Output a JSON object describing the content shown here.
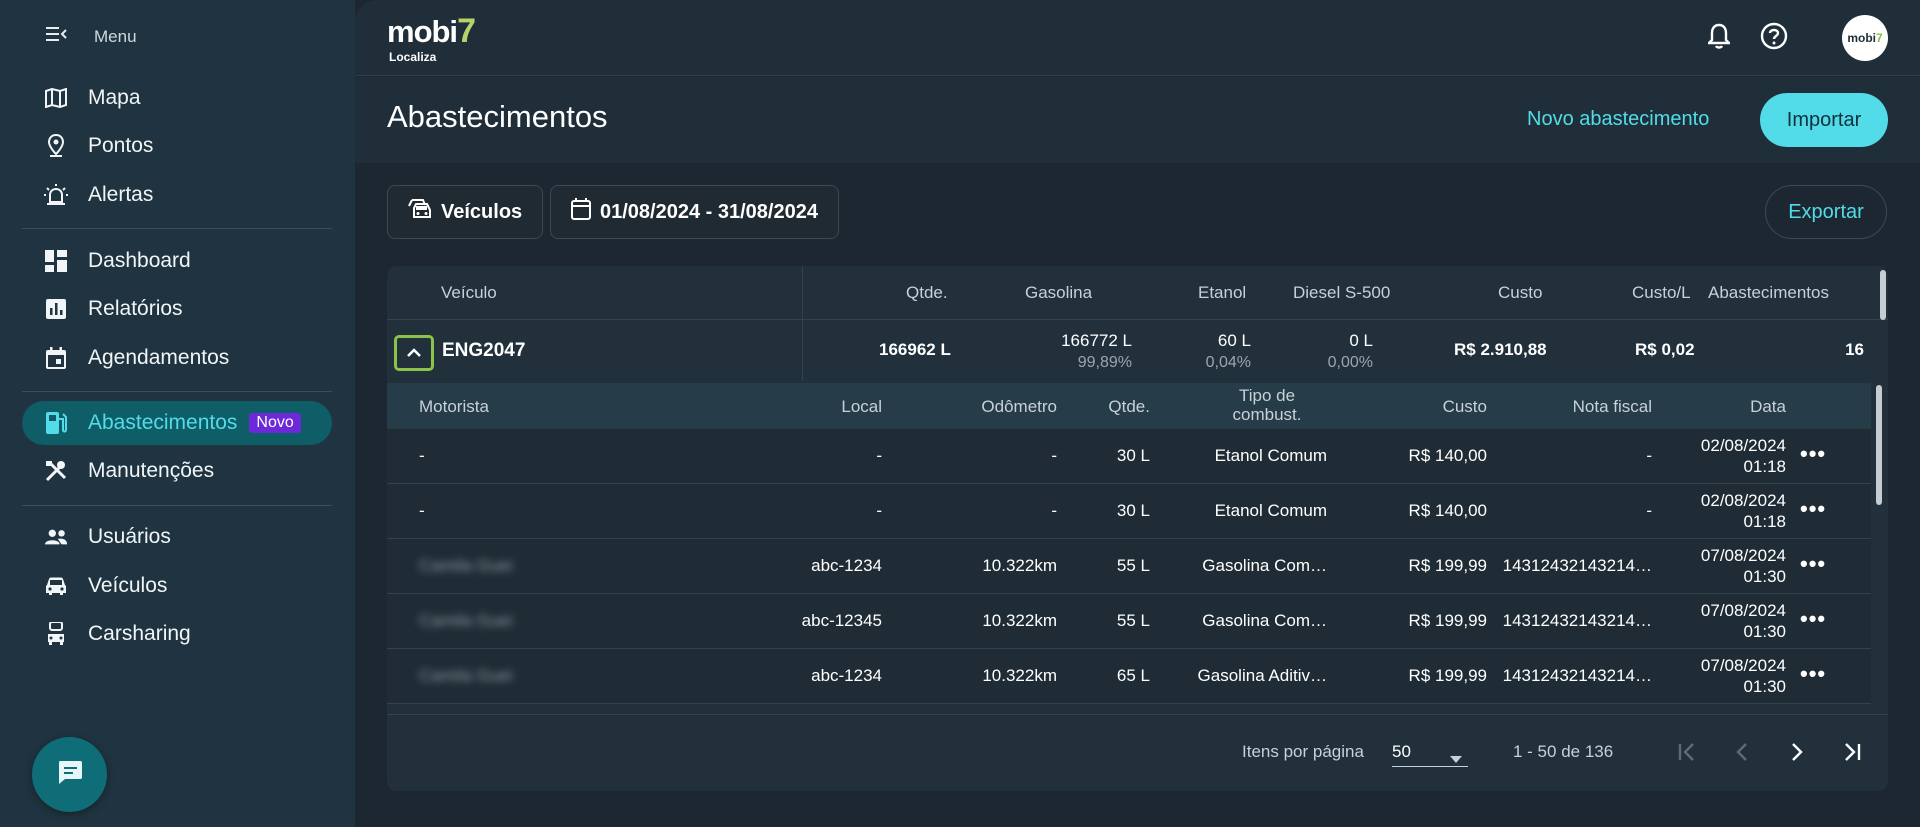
{
  "sidebar": {
    "menu_label": "Menu",
    "items": [
      {
        "label": "Mapa",
        "icon": "map-icon"
      },
      {
        "label": "Pontos",
        "icon": "pin-icon"
      },
      {
        "label": "Alertas",
        "icon": "siren-icon"
      },
      {
        "label": "Dashboard",
        "icon": "dashboard-icon"
      },
      {
        "label": "Relatórios",
        "icon": "report-icon"
      },
      {
        "label": "Agendamentos",
        "icon": "calendar-icon"
      },
      {
        "label": "Abastecimentos",
        "icon": "fuel-icon",
        "badge": "Novo",
        "active": true
      },
      {
        "label": "Manutenções",
        "icon": "tools-icon"
      },
      {
        "label": "Usuários",
        "icon": "users-icon"
      },
      {
        "label": "Veículos",
        "icon": "car-icon"
      },
      {
        "label": "Carsharing",
        "icon": "carsharing-icon"
      }
    ]
  },
  "header": {
    "logo_word": "mobi",
    "logo_seven": "7",
    "logo_sub": "Localiza",
    "avatar_text": "mobi",
    "avatar_seven": "7"
  },
  "page": {
    "title": "Abastecimentos",
    "new_link": "Novo abastecimento",
    "import_label": "Importar",
    "vehicles_filter": "Veículos",
    "date_range": "01/08/2024 - 31/08/2024",
    "export_label": "Exportar"
  },
  "vehicle_table": {
    "columns": [
      "Veículo",
      "Qtde.",
      "Gasolina",
      "Etanol",
      "Diesel S-500",
      "Custo",
      "Custo/L",
      "Abastecimentos"
    ],
    "row": {
      "plate": "ENG2047",
      "qtde": "166962 L",
      "gasolina": "166772 L",
      "gasolina_pct": "99,89%",
      "etanol": "60 L",
      "etanol_pct": "0,04%",
      "diesel": "0 L",
      "diesel_pct": "0,00%",
      "custo": "R$ 2.910,88",
      "custo_l": "R$ 0,02",
      "abastecimentos": "16"
    }
  },
  "detail_table": {
    "columns": {
      "motorista": "Motorista",
      "local": "Local",
      "odometro": "Odômetro",
      "qtde": "Qtde.",
      "tipo_1": "Tipo de",
      "tipo_2": "combust.",
      "custo": "Custo",
      "nota": "Nota fiscal",
      "data": "Data"
    },
    "rows": [
      {
        "motorista": "-",
        "local": "-",
        "odometro": "-",
        "qtde": "30 L",
        "tipo": "Etanol Comum",
        "custo": "R$ 140,00",
        "nota": "-",
        "data": "02/08/2024",
        "hora": "01:18"
      },
      {
        "motorista": "-",
        "local": "-",
        "odometro": "-",
        "qtde": "30 L",
        "tipo": "Etanol Comum",
        "custo": "R$ 140,00",
        "nota": "-",
        "data": "02/08/2024",
        "hora": "01:18"
      },
      {
        "motorista": "Camila Guei",
        "local": "abc-1234",
        "odometro": "10.322km",
        "qtde": "55 L",
        "tipo": "Gasolina Com…",
        "custo": "R$ 199,99",
        "nota": "14312432143214…",
        "data": "07/08/2024",
        "hora": "01:30"
      },
      {
        "motorista": "Camila Guei",
        "local": "abc-12345",
        "odometro": "10.322km",
        "qtde": "55 L",
        "tipo": "Gasolina Com…",
        "custo": "R$ 199,99",
        "nota": "14312432143214…",
        "data": "07/08/2024",
        "hora": "01:30"
      },
      {
        "motorista": "Camila Guei",
        "local": "abc-1234",
        "odometro": "10.322km",
        "qtde": "65 L",
        "tipo": "Gasolina Aditiv…",
        "custo": "R$ 199,99",
        "nota": "14312432143214…",
        "data": "07/08/2024",
        "hora": "01:30"
      }
    ]
  },
  "pager": {
    "per_page_label": "Itens por página",
    "per_page_value": "50",
    "range": "1 - 50 de 136"
  },
  "colors": {
    "accent": "#52dce9",
    "badge": "#6d28d9",
    "sidebar_bg": "#1f3440",
    "main_bg": "#1c2731"
  }
}
